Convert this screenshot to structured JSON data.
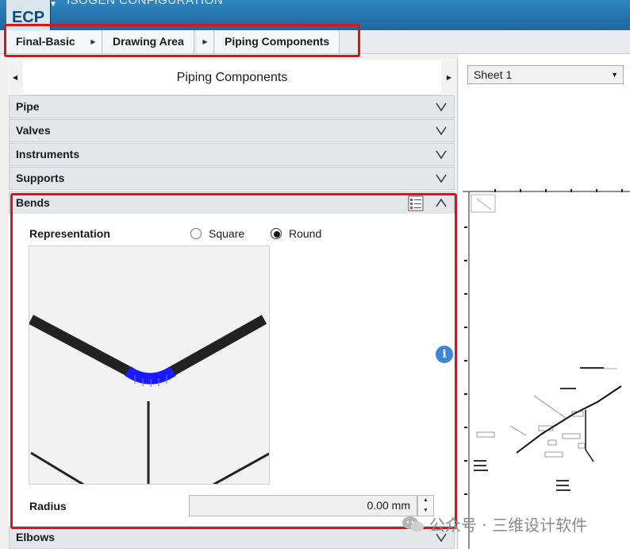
{
  "app": {
    "logo_text": "ECP",
    "title": "ISOGEN CONFIGURATION"
  },
  "breadcrumb": {
    "items": [
      "Final-Basic",
      "Drawing Area",
      "Piping Components"
    ]
  },
  "panel": {
    "title": "Piping Components",
    "sections": {
      "pipe": "Pipe",
      "valves": "Valves",
      "instruments": "Instruments",
      "supports": "Supports",
      "bends": "Bends",
      "elbows": "Elbows"
    }
  },
  "bends": {
    "representation_label": "Representation",
    "options": [
      "Square",
      "Round"
    ],
    "selected_option": "Round",
    "radius_label": "Radius",
    "radius_value": "0.00 mm"
  },
  "sheet": {
    "selected": "Sheet 1"
  },
  "watermark": {
    "text": "公众号 · 三维设计软件"
  },
  "colors": {
    "highlight": "#e3101a",
    "title_bar": "#1f6fa8",
    "bend_arc": "#1a1aff",
    "info": "#3d86d6"
  }
}
